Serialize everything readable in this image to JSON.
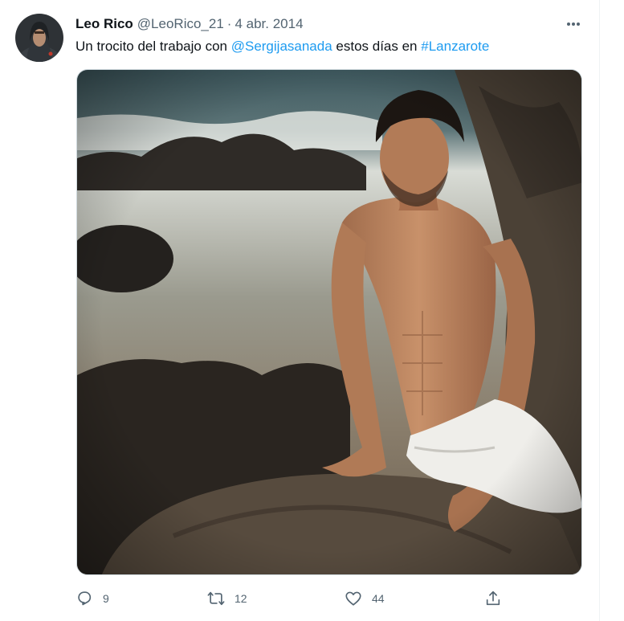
{
  "tweet": {
    "display_name": "Leo Rico",
    "handle": "@LeoRico_21",
    "separator": "·",
    "date": "4 abr. 2014",
    "text_before": "Un trocito del trabajo con ",
    "mention": "@Sergijasanada",
    "text_middle": " estos días en ",
    "hashtag": "#Lanzarote"
  },
  "icons": {
    "more": "more-horizontal-icon",
    "reply": "reply-icon",
    "retweet": "retweet-icon",
    "like": "heart-icon",
    "share": "share-icon"
  },
  "actions": {
    "reply_count": "9",
    "retweet_count": "12",
    "like_count": "44"
  },
  "colors": {
    "accent": "#1d9bf0",
    "secondary_text": "#536471"
  }
}
